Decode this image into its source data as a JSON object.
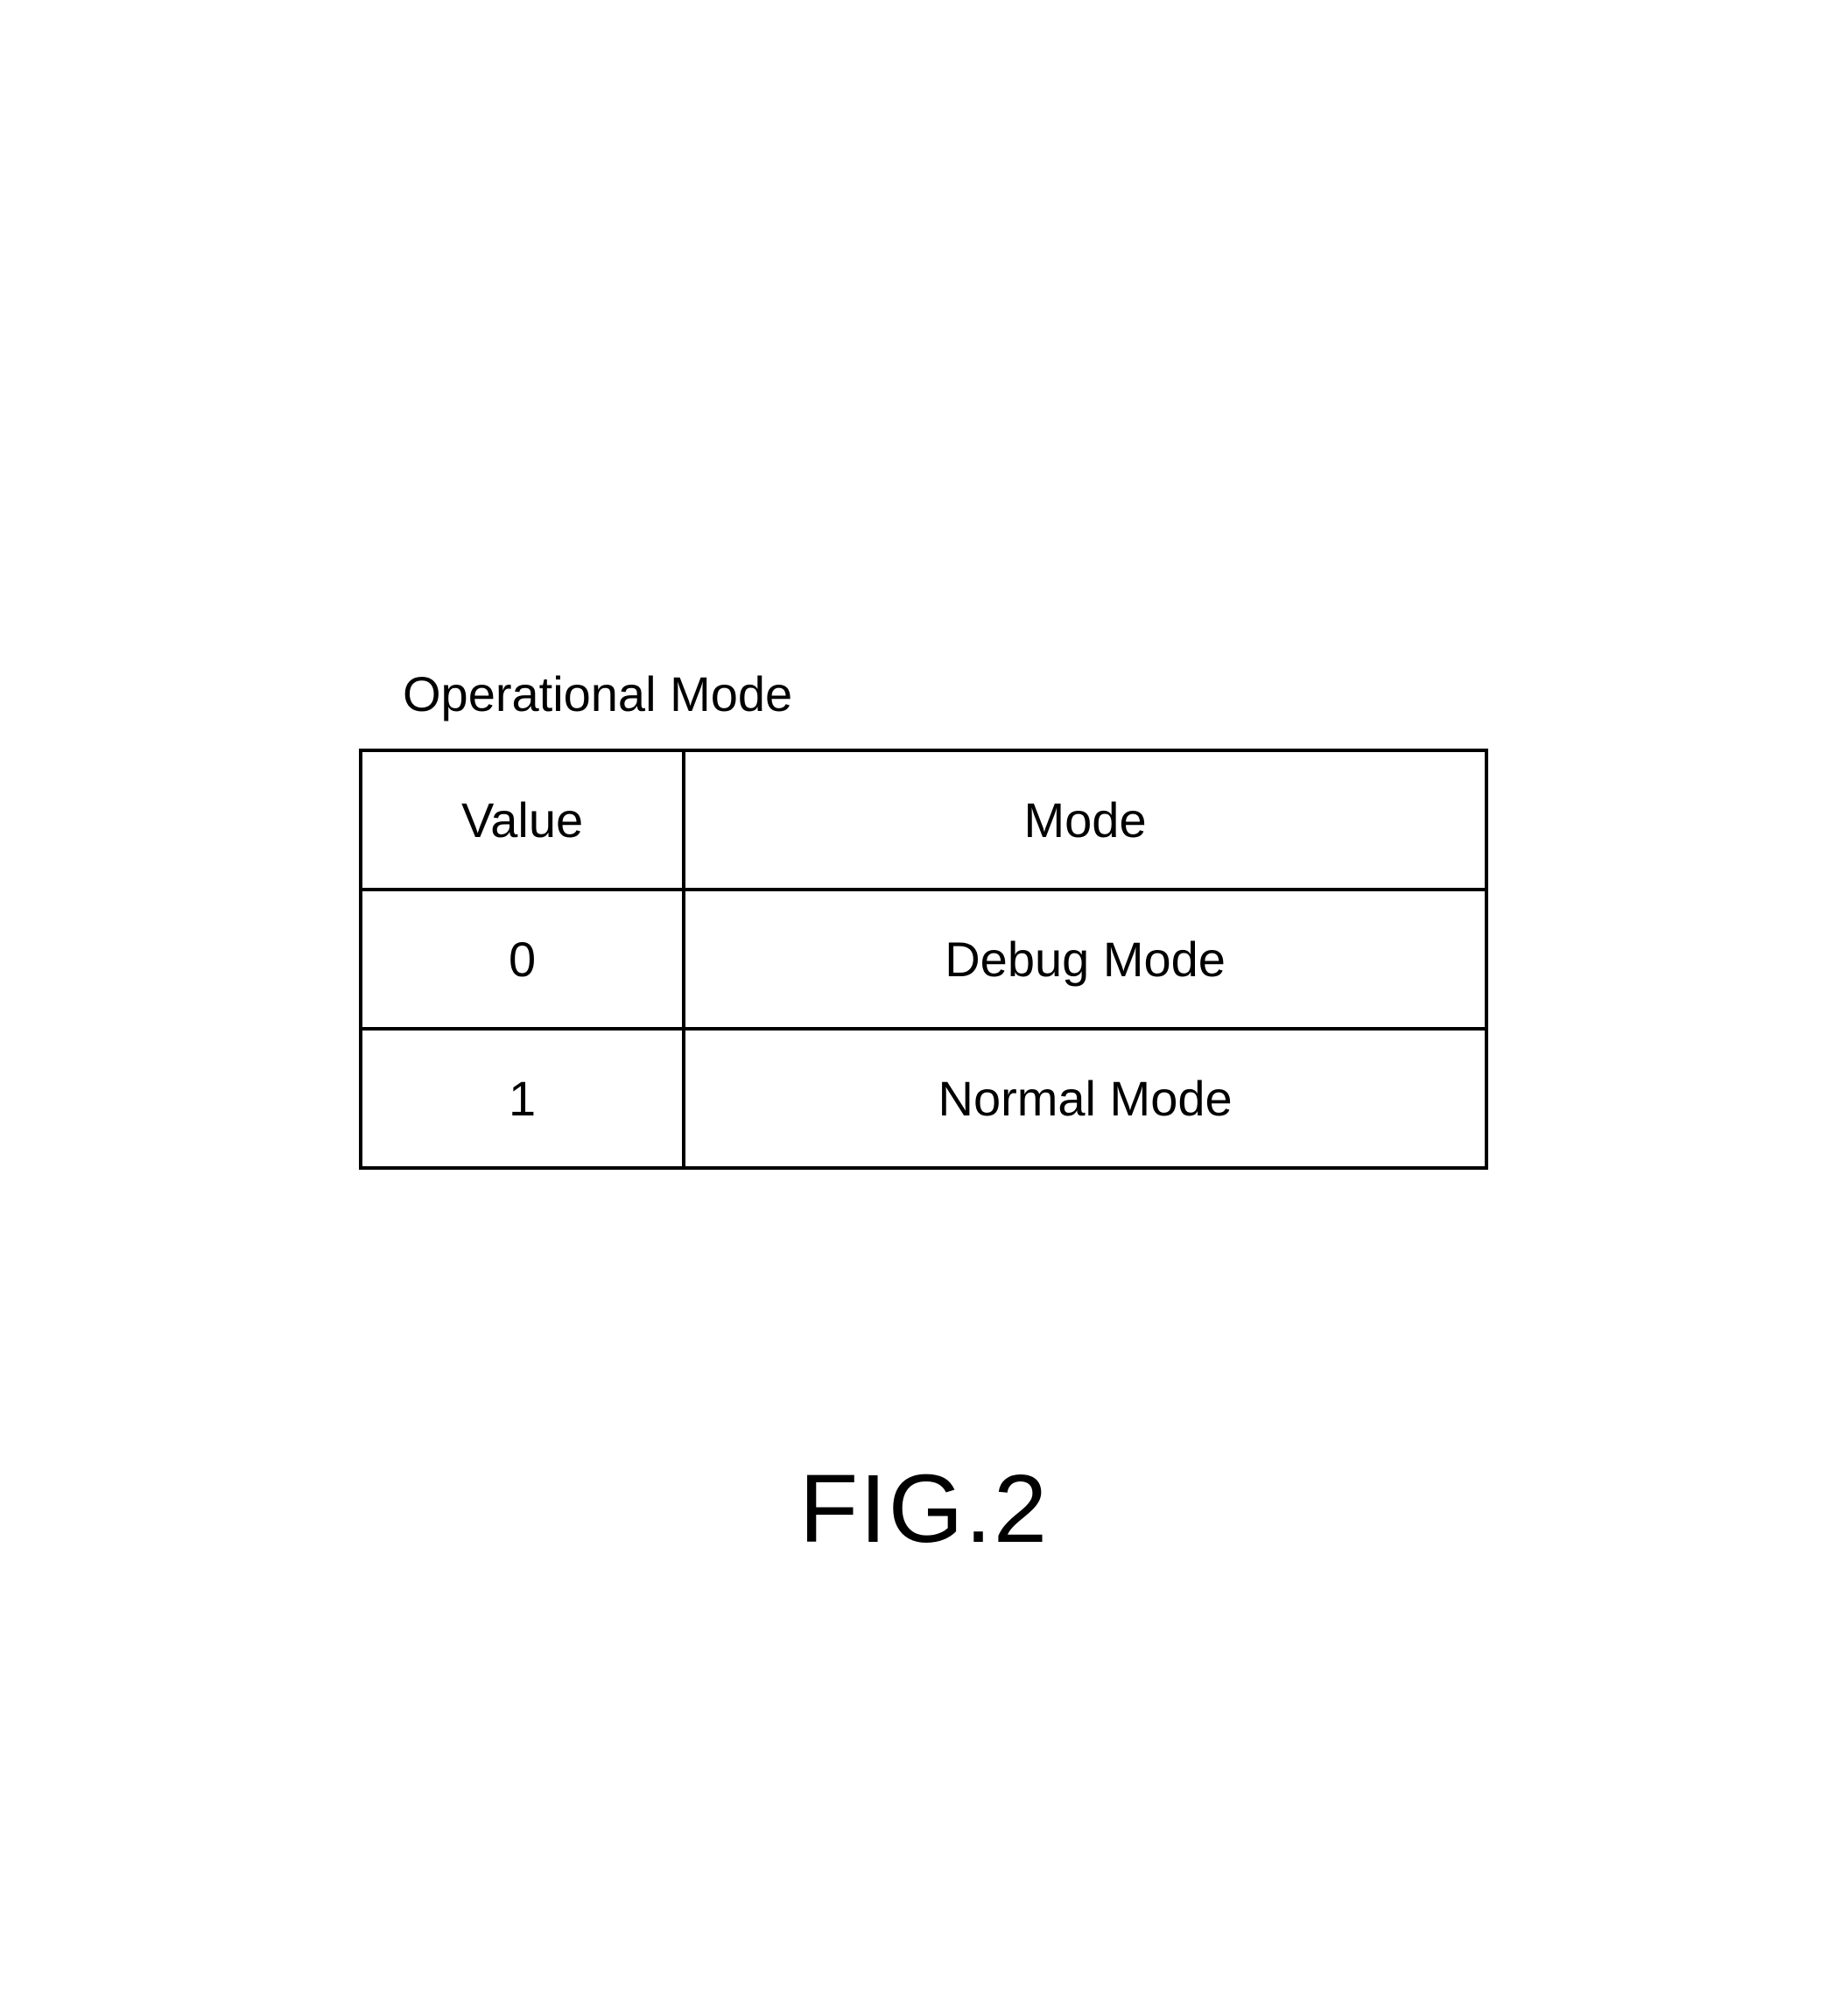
{
  "table": {
    "title": "Operational Mode",
    "headers": {
      "col1": "Value",
      "col2": "Mode"
    },
    "rows": [
      {
        "value": "0",
        "mode": "Debug Mode"
      },
      {
        "value": "1",
        "mode": "Normal Mode"
      }
    ]
  },
  "figure_label": "FIG.2"
}
